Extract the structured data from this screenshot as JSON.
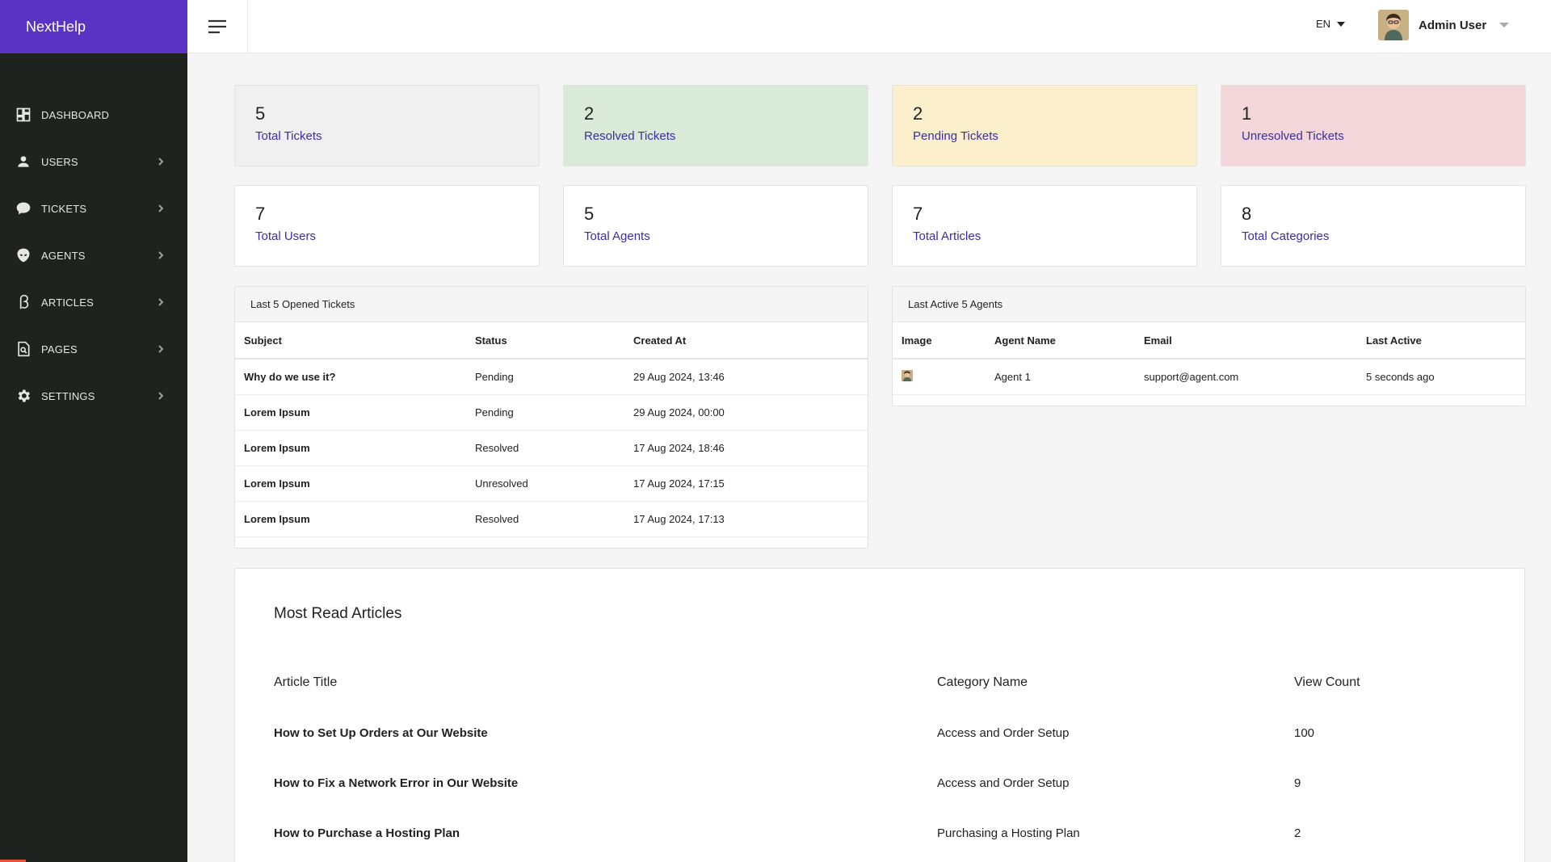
{
  "app": {
    "brand": "NextHelp"
  },
  "sidebar": {
    "items": [
      {
        "label": "DASHBOARD",
        "icon": "dashboard-icon"
      },
      {
        "label": "USERS",
        "icon": "user-icon"
      },
      {
        "label": "TICKETS",
        "icon": "chat-icon"
      },
      {
        "label": "AGENTS",
        "icon": "alien-icon"
      },
      {
        "label": "ARTICLES",
        "icon": "beta-icon"
      },
      {
        "label": "PAGES",
        "icon": "page-search-icon"
      },
      {
        "label": "SETTINGS",
        "icon": "gear-icon"
      }
    ]
  },
  "topbar": {
    "language": "EN",
    "user_name": "Admin User"
  },
  "stats": {
    "total_tickets": {
      "value": "5",
      "label": "Total Tickets",
      "color": "#f0f0f0"
    },
    "resolved_tickets": {
      "value": "2",
      "label": "Resolved Tickets",
      "color": "#d9ead9"
    },
    "pending_tickets": {
      "value": "2",
      "label": "Pending Tickets",
      "color": "#fcf0cc"
    },
    "unresolved_tickets": {
      "value": "1",
      "label": "Unresolved Tickets",
      "color": "#f3d6da"
    },
    "total_users": {
      "value": "7",
      "label": "Total Users"
    },
    "total_agents": {
      "value": "5",
      "label": "Total Agents"
    },
    "total_articles": {
      "value": "7",
      "label": "Total Articles"
    },
    "total_categories": {
      "value": "8",
      "label": "Total Categories"
    }
  },
  "tickets_panel": {
    "title": "Last 5 Opened Tickets",
    "columns": [
      "Subject",
      "Status",
      "Created At"
    ],
    "rows": [
      {
        "subject": "Why do we use it?",
        "status": "Pending",
        "created": "29 Aug 2024, 13:46"
      },
      {
        "subject": "Lorem Ipsum",
        "status": "Pending",
        "created": "29 Aug 2024, 00:00"
      },
      {
        "subject": "Lorem Ipsum",
        "status": "Resolved",
        "created": "17 Aug 2024, 18:46"
      },
      {
        "subject": "Lorem Ipsum",
        "status": "Unresolved",
        "created": "17 Aug 2024, 17:15"
      },
      {
        "subject": "Lorem Ipsum",
        "status": "Resolved",
        "created": "17 Aug 2024, 17:13"
      }
    ]
  },
  "agents_panel": {
    "title": "Last Active 5 Agents",
    "columns": [
      "Image",
      "Agent Name",
      "Email",
      "Last Active"
    ],
    "rows": [
      {
        "name": "Agent 1",
        "email": "support@agent.com",
        "last_active": "5 seconds ago"
      }
    ]
  },
  "articles": {
    "title": "Most Read Articles",
    "columns": [
      "Article Title",
      "Category Name",
      "View Count"
    ],
    "rows": [
      {
        "title": "How to Set Up Orders at Our Website",
        "category": "Access and Order Setup",
        "views": "100"
      },
      {
        "title": "How to Fix a Network Error in Our Website",
        "category": "Access and Order Setup",
        "views": "9"
      },
      {
        "title": "How to Purchase a Hosting Plan",
        "category": "Purchasing a Hosting Plan",
        "views": "2"
      }
    ]
  }
}
